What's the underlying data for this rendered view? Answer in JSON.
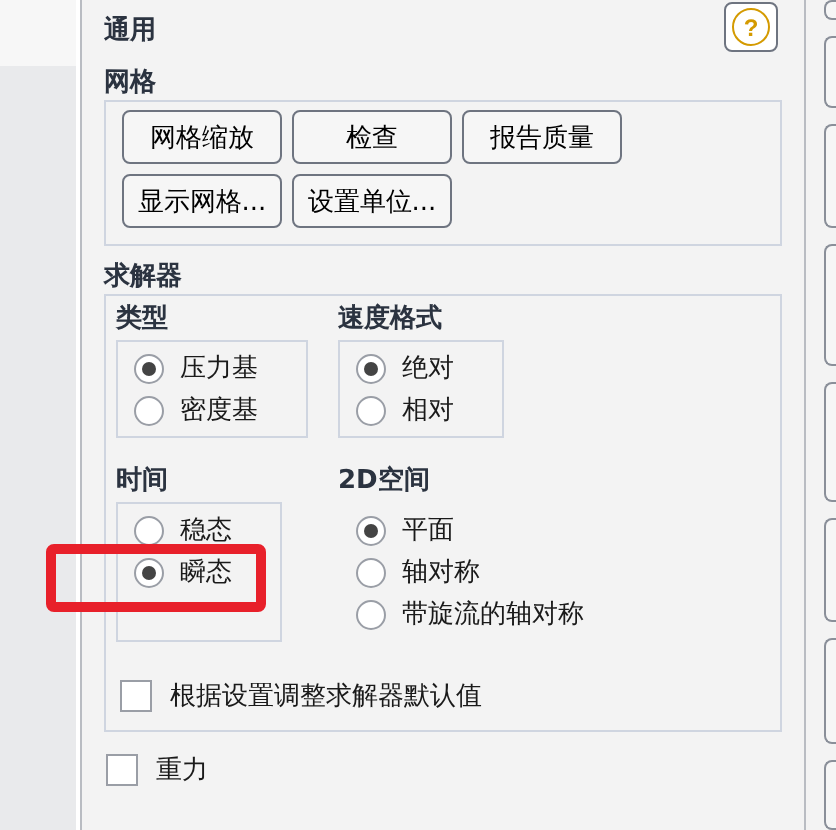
{
  "section_title": "通用",
  "help_button": "?",
  "mesh": {
    "title": "网格",
    "buttons": [
      "网格缩放",
      "检查",
      "报告质量",
      "显示网格...",
      "设置单位..."
    ]
  },
  "solver": {
    "title": "求解器",
    "groups": [
      {
        "title": "类型",
        "framed": true,
        "options": [
          {
            "label": "压力基",
            "selected": true
          },
          {
            "label": "密度基",
            "selected": false
          }
        ]
      },
      {
        "title": "速度格式",
        "framed": true,
        "options": [
          {
            "label": "绝对",
            "selected": true
          },
          {
            "label": "相对",
            "selected": false
          }
        ]
      },
      {
        "title": "时间",
        "framed": true,
        "options": [
          {
            "label": "稳态",
            "selected": false
          },
          {
            "label": "瞬态",
            "selected": true
          }
        ]
      },
      {
        "title": "2D空间",
        "framed": false,
        "options": [
          {
            "label": "平面",
            "selected": true
          },
          {
            "label": "轴对称",
            "selected": false
          },
          {
            "label": "带旋流的轴对称",
            "selected": false
          }
        ]
      }
    ],
    "adjust_defaults": {
      "label": "根据设置调整求解器默认值",
      "checked": false
    }
  },
  "gravity": {
    "label": "重力",
    "checked": false
  }
}
